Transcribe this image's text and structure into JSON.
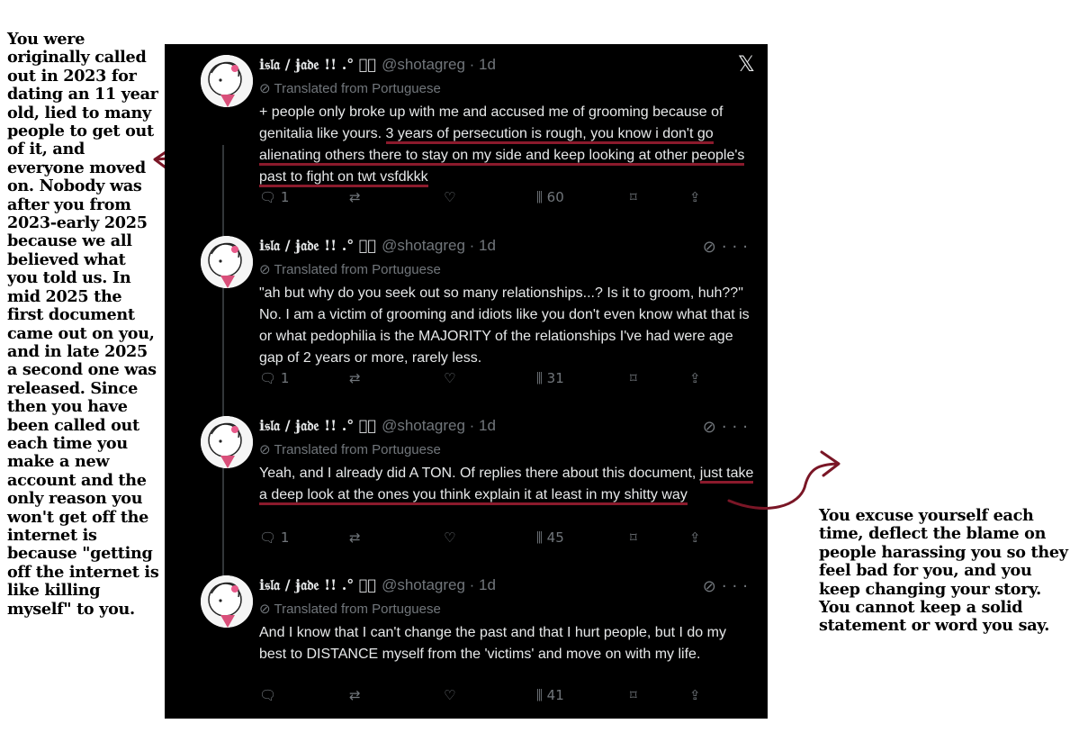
{
  "left_note": "You were originally called out in 2023 for dating an 11 year old, lied to many people to get out of it, and everyone moved on. Nobody was after you from 2023-early 2025 because we all believed what you told us. In mid 2025 the first document came out on you, and in late 2025 a second one was released. Since then you have been called out each time you make a new account and the only reason you won't get off the internet is because \"getting off the internet is like killing myself\" to you.",
  "right_note": "You excuse yourself each time, deflect the blame on people harassing you so they feel bad for you, and you keep changing your story. You cannot keep a solid statement or word you say.",
  "colors": {
    "panel_bg": "#000000",
    "text": "#e7e9ea",
    "muted": "#71767b",
    "underline": "#8b1a2c"
  },
  "tweets": [
    {
      "display_name": "i𝔰𝔩𝔞 / ɉ𝔞𝔡𝔢 !! .° ꒰ͦ",
      "handle": "@shotagreg · 1d",
      "translated": "Translated from Portuguese",
      "text_a": "+ people only broke up with me and accused me of grooming because of genitalia like yours. ",
      "text_u": "3 years of persecution is rough, you know  i don't go alienating others there to stay on my side and keep looking at other people's past to fight on twt vsfdkkk",
      "text_b": "",
      "replies": "1",
      "views": "60"
    },
    {
      "display_name": "i𝔰𝔩𝔞 / ɉ𝔞𝔡𝔢 !! .° ꒰ͦ",
      "handle": "@shotagreg · 1d",
      "translated": "Translated from Portuguese",
      "text_a": "\"ah but why do you seek out so many relationships...? Is it to groom, huh??\" No. I am a victim of grooming and idiots like you don't even know what that is or what pedophilia is the MAJORITY of the relationships I've had were age gap of 2 years or more, rarely less.",
      "text_u": "",
      "text_b": "",
      "replies": "1",
      "views": "31"
    },
    {
      "display_name": "i𝔰𝔩𝔞 / ɉ𝔞𝔡𝔢 !! .° ꒰ͦ",
      "handle": "@shotagreg · 1d",
      "translated": "Translated from Portuguese",
      "text_a": "Yeah, and I already did A TON. Of replies there about this document, ",
      "text_u": "just take a deep look at the ones you think explain it at least in my shitty way",
      "text_b": "",
      "replies": "1",
      "views": "45"
    },
    {
      "display_name": "i𝔰𝔩𝔞 / ɉ𝔞𝔡𝔢 !! .° ꒰ͦ",
      "handle": "@shotagreg · 1d",
      "translated": "Translated from Portuguese",
      "text_a": "And I know that I can't change the past and that I hurt people, but I do my best to DISTANCE myself from the 'victims' and move on with my life.",
      "text_u": "",
      "text_b": "",
      "replies": "",
      "views": "41"
    }
  ]
}
